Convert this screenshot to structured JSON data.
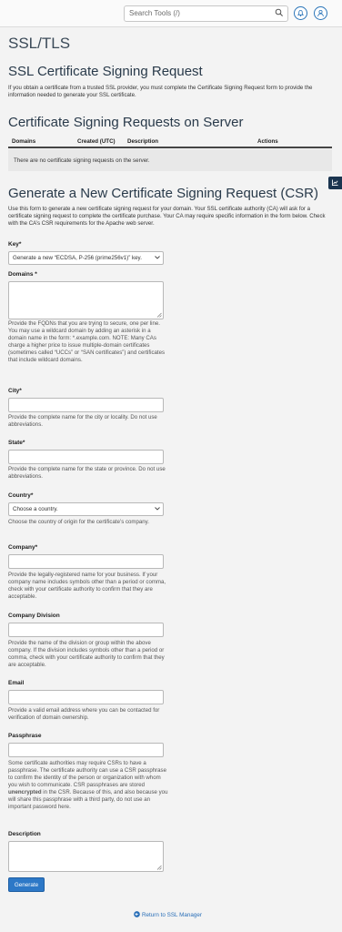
{
  "header": {
    "search_placeholder": "Search Tools (/)"
  },
  "page": {
    "title": "SSL/TLS"
  },
  "csr_intro": {
    "heading": "SSL Certificate Signing Request",
    "text": "If you obtain a certificate from a trusted SSL provider, you must complete the Certificate Signing Request form to provide the information needed to generate your SSL certificate."
  },
  "server_csrs": {
    "heading": "Certificate Signing Requests on Server",
    "columns": [
      "Domains",
      "Created (UTC)",
      "Description",
      "Actions"
    ],
    "empty_text": "There are no certificate signing requests on the server."
  },
  "form": {
    "heading": "Generate a New Certificate Signing Request (CSR)",
    "intro_text": "Use this form to generate a new certificate signing request for your domain. Your SSL certificate authority (CA) will ask for a certificate signing request to complete the certificate purchase. Your CA may require specific information in the form below. Check with the CA’s CSR requirements for the Apache web server.",
    "key_label": "Key*",
    "key_value": "Generate a new “ECDSA, P-256 (prime256v1)” key.",
    "domains_label": "Domains *",
    "domains_help": "Provide the FQDNs that you are trying to secure, one per line. You may use a wildcard domain by adding an asterisk in a domain name in the form: *.example.com. NOTE: Many CAs charge a higher price to issue multiple-domain certificates (sometimes called “UCCs” or “SAN certificates”) and certificates that include wildcard domains.",
    "city_label": "City*",
    "city_help": "Provide the complete name for the city or locality. Do not use abbreviations.",
    "state_label": "State*",
    "state_help": "Provide the complete name for the state or province. Do not use abbreviations.",
    "country_label": "Country*",
    "country_value": "Choose a country.",
    "country_help": "Choose the country of origin for the certificate’s company.",
    "company_label": "Company*",
    "company_help": "Provide the legally-registered name for your business. If your company name includes symbols other than a period or comma, check with your certificate authority to confirm that they are acceptable.",
    "division_label": "Company Division",
    "division_help": "Provide the name of the division or group within the above company. If the division includes symbols other than a period or comma, check with your certificate authority to confirm that they are acceptable.",
    "email_label": "Email",
    "email_help": "Provide a valid email address where you can be contacted for verification of domain ownership.",
    "passphrase_label": "Passphrase",
    "passphrase_help_1": "Some certificate authorities may require CSRs to have a passphrase. The certificate authority can use a CSR passphrase to confirm the identity of the person or organization with whom you wish to communicate. CSR passphrases are stored ",
    "passphrase_help_bold": "unencrypted",
    "passphrase_help_2": " in the CSR. Because of this, and also because you will share this passphrase with a third party, do not use an important password here.",
    "description_label": "Description",
    "generate_label": "Generate"
  },
  "footer": {
    "return_label": "Return to SSL Manager"
  },
  "colors": {
    "primary": "#2d78c7",
    "side_tab": "#1b3550"
  }
}
